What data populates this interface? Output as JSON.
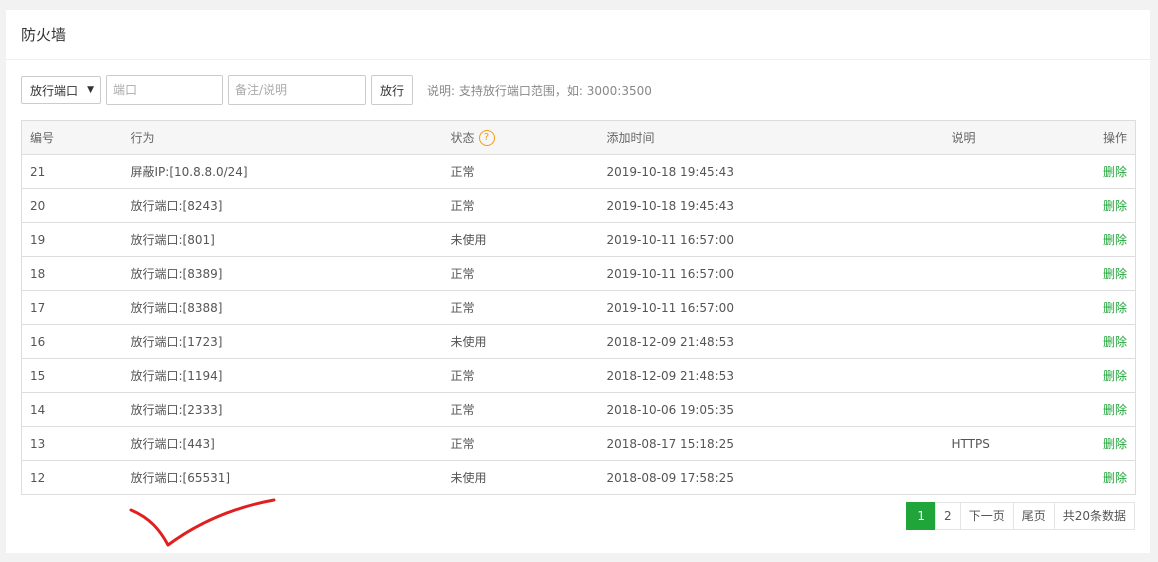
{
  "title": "防火墙",
  "toolbar": {
    "select_value": "放行端口",
    "port_placeholder": "端口",
    "note_placeholder": "备注/说明",
    "submit_label": "放行",
    "hint": "说明: 支持放行端口范围，如: 3000:3500"
  },
  "table": {
    "headers": [
      "编号",
      "行为",
      "状态",
      "添加时间",
      "说明",
      "操作"
    ],
    "rows": [
      {
        "id": "21",
        "action": "屏蔽IP:[10.8.8.0/24]",
        "status": "正常",
        "time": "2019-10-18 19:45:43",
        "note": "",
        "op": "删除"
      },
      {
        "id": "20",
        "action": "放行端口:[8243]",
        "status": "正常",
        "time": "2019-10-18 19:45:43",
        "note": "",
        "op": "删除"
      },
      {
        "id": "19",
        "action": "放行端口:[801]",
        "status": "未使用",
        "time": "2019-10-11 16:57:00",
        "note": "",
        "op": "删除"
      },
      {
        "id": "18",
        "action": "放行端口:[8389]",
        "status": "正常",
        "time": "2019-10-11 16:57:00",
        "note": "",
        "op": "删除"
      },
      {
        "id": "17",
        "action": "放行端口:[8388]",
        "status": "正常",
        "time": "2019-10-11 16:57:00",
        "note": "",
        "op": "删除"
      },
      {
        "id": "16",
        "action": "放行端口:[1723]",
        "status": "未使用",
        "time": "2018-12-09 21:48:53",
        "note": "",
        "op": "删除"
      },
      {
        "id": "15",
        "action": "放行端口:[1194]",
        "status": "正常",
        "time": "2018-12-09 21:48:53",
        "note": "",
        "op": "删除"
      },
      {
        "id": "14",
        "action": "放行端口:[2333]",
        "status": "正常",
        "time": "2018-10-06 19:05:35",
        "note": "",
        "op": "删除"
      },
      {
        "id": "13",
        "action": "放行端口:[443]",
        "status": "正常",
        "time": "2018-08-17 15:18:25",
        "note": "HTTPS",
        "op": "删除"
      },
      {
        "id": "12",
        "action": "放行端口:[65531]",
        "status": "未使用",
        "time": "2018-08-09 17:58:25",
        "note": "",
        "op": "删除"
      }
    ]
  },
  "pager": {
    "pages": [
      "1",
      "2"
    ],
    "current": "1",
    "next": "下一页",
    "last": "尾页",
    "total": "共20条数据"
  },
  "colors": {
    "accent": "#20a53a",
    "help": "#f39c12",
    "annotation": "#e02020"
  }
}
